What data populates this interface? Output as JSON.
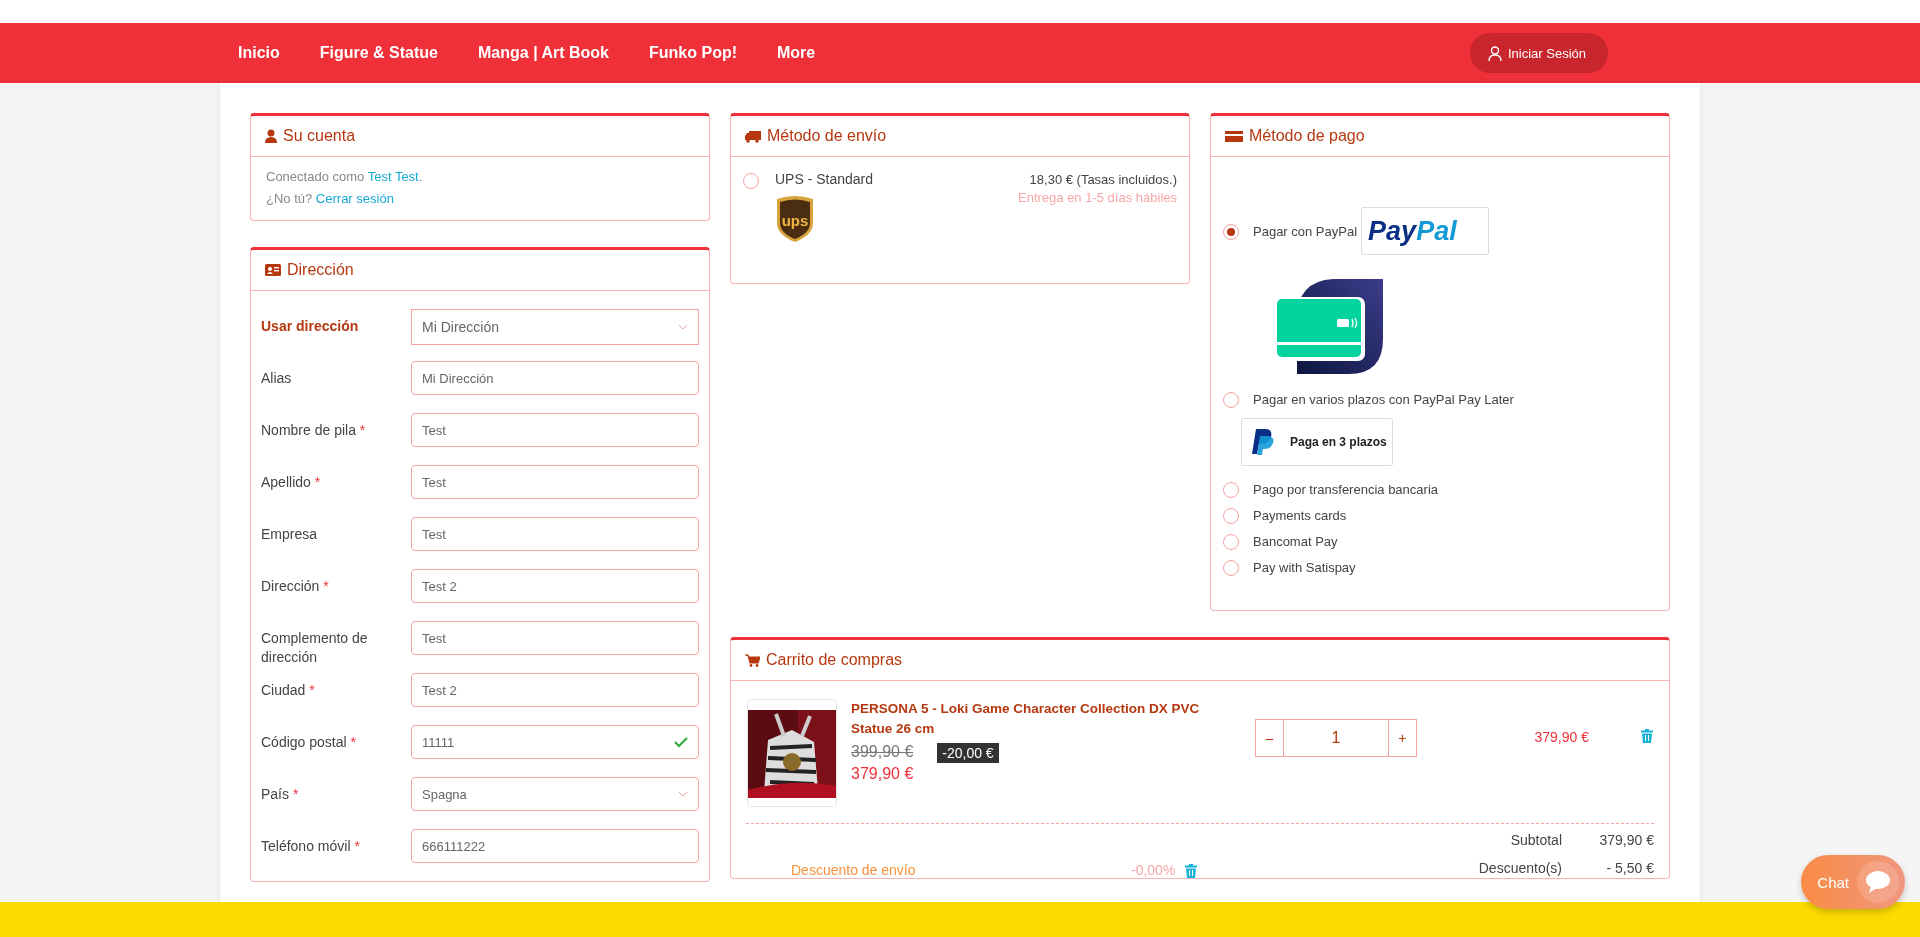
{
  "nav": {
    "items": [
      {
        "label": "Inicio"
      },
      {
        "label": "Figure & Statue"
      },
      {
        "label": "Manga | Art Book"
      },
      {
        "label": "Funko Pop!"
      },
      {
        "label": "More"
      }
    ],
    "login": "Iniciar Sesión"
  },
  "account": {
    "title": "Su cuenta",
    "lines": [
      {
        "text": "Conectado como ",
        "link": "Test Test",
        "after": "."
      },
      {
        "text": "¿No tú? ",
        "link": "Cerrar sesión"
      }
    ]
  },
  "address": {
    "title": "Dirección",
    "fields": [
      {
        "label": "Usar dirección",
        "kind": "picker",
        "value": "Mi Dirección"
      },
      {
        "label": "Alias",
        "kind": "text",
        "value": "Mi Dirección"
      },
      {
        "label": "Nombre de pila",
        "asterisk": "*",
        "kind": "text",
        "value": "Test"
      },
      {
        "label": "Apellido",
        "asterisk": "*",
        "kind": "text",
        "value": "Test"
      },
      {
        "label": "Empresa",
        "kind": "text",
        "value": "Test"
      },
      {
        "label": "Dirección",
        "asterisk": "*",
        "kind": "text",
        "value": "Test 2"
      },
      {
        "label": "Complemento de dirección",
        "kind": "text",
        "value": "Test"
      },
      {
        "label": "Ciudad",
        "asterisk": "*",
        "kind": "text",
        "value": "Test 2"
      },
      {
        "label": "Código postal",
        "asterisk": "*",
        "kind": "text",
        "value": "11111",
        "valid": true
      },
      {
        "label": "País",
        "asterisk": "*",
        "kind": "select",
        "value": "Spagna"
      },
      {
        "label": "Teléfono móvil",
        "asterisk": "*",
        "kind": "text",
        "value": "666111222"
      }
    ]
  },
  "shipping": {
    "title": "Método de envío",
    "options": [
      {
        "name": "UPS - Standard",
        "selected": false,
        "price": "18,30 € (Tasas incluidos.)",
        "delay": "Entrega en 1-5 días hábiles",
        "logo_text": "ups"
      }
    ]
  },
  "payment": {
    "title": "Método de pago",
    "options": [
      {
        "kind": "paypal",
        "label": "Pagar con PayPal",
        "selected": true,
        "logo_parts": [
          "Pay",
          "Pal"
        ]
      },
      {
        "kind": "paylater",
        "label": "Pagar en varios plazos con PayPal Pay Later",
        "selected": false,
        "badge_text": "Paga en 3 plazos"
      },
      {
        "kind": "plain",
        "label": "Pago por transferencia bancaria",
        "selected": false
      },
      {
        "kind": "plain",
        "label": "Payments cards",
        "selected": false
      },
      {
        "kind": "plain",
        "label": "Bancomat Pay",
        "selected": false
      },
      {
        "kind": "plain",
        "label": "Pay with Satispay",
        "selected": false
      }
    ]
  },
  "cart": {
    "title": "Carrito de compras",
    "items": [
      {
        "name": "PERSONA 5 - Loki Game Character Collection DX PVC Statue 26 cm",
        "old_price": "399,90 €",
        "discount": "-20,00 €",
        "price": "379,90 €",
        "quantity": "1",
        "minus": "–",
        "plus": "+",
        "total": "379,90 €"
      }
    ],
    "voucher": {
      "label": "Descuento de envío",
      "value": "-0,00%"
    },
    "totals": [
      {
        "label": "Subtotal",
        "value": "379,90 €"
      },
      {
        "label": "Descuento(s)",
        "value": "- 5,50 €"
      }
    ]
  },
  "chat": {
    "label": "Chat"
  }
}
